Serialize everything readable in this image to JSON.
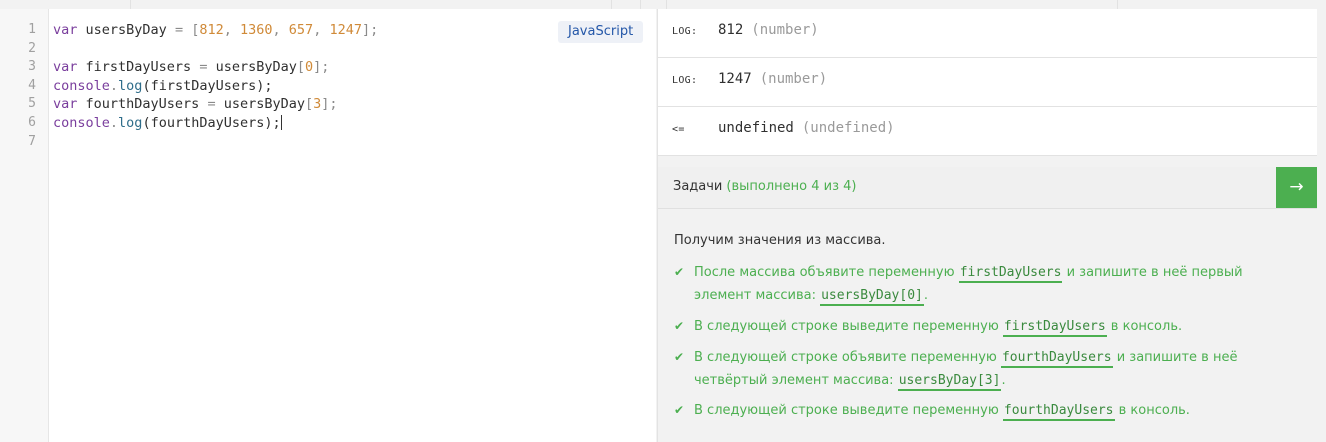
{
  "editor": {
    "language": "JavaScript",
    "line_numbers": [
      "1",
      "2",
      "3",
      "4",
      "5",
      "6",
      "7"
    ],
    "lines": [
      [
        {
          "t": "var",
          "c": "kw"
        },
        {
          "t": " usersByDay "
        },
        {
          "t": "=",
          "c": "punc"
        },
        {
          "t": " "
        },
        {
          "t": "[",
          "c": "punc"
        },
        {
          "t": "812",
          "c": "num"
        },
        {
          "t": ", ",
          "c": "punc"
        },
        {
          "t": "1360",
          "c": "num"
        },
        {
          "t": ", ",
          "c": "punc"
        },
        {
          "t": "657",
          "c": "num"
        },
        {
          "t": ", ",
          "c": "punc"
        },
        {
          "t": "1247",
          "c": "num"
        },
        {
          "t": "];",
          "c": "punc"
        }
      ],
      [],
      [
        {
          "t": "var",
          "c": "kw"
        },
        {
          "t": " firstDayUsers "
        },
        {
          "t": "=",
          "c": "punc"
        },
        {
          "t": " usersByDay"
        },
        {
          "t": "[",
          "c": "punc"
        },
        {
          "t": "0",
          "c": "num"
        },
        {
          "t": "];",
          "c": "punc"
        }
      ],
      [
        {
          "t": "console",
          "c": "kw"
        },
        {
          "t": ".",
          "c": "punc"
        },
        {
          "t": "log",
          "c": "fn"
        },
        {
          "t": "(firstDayUsers);"
        }
      ],
      [
        {
          "t": "var",
          "c": "kw"
        },
        {
          "t": " fourthDayUsers "
        },
        {
          "t": "=",
          "c": "punc"
        },
        {
          "t": " usersByDay"
        },
        {
          "t": "[",
          "c": "punc"
        },
        {
          "t": "3",
          "c": "num"
        },
        {
          "t": "];",
          "c": "punc"
        }
      ],
      [
        {
          "t": "console",
          "c": "kw"
        },
        {
          "t": ".",
          "c": "punc"
        },
        {
          "t": "log",
          "c": "fn"
        },
        {
          "t": "(fourthDayUsers);"
        }
      ],
      []
    ]
  },
  "console": {
    "rows": [
      {
        "tag": "LOG:",
        "value": "812",
        "type": "(number)"
      },
      {
        "tag": "LOG:",
        "value": "1247",
        "type": "(number)"
      },
      {
        "tag": "<=",
        "value": "undefined",
        "type": "(undefined)"
      }
    ]
  },
  "tasks": {
    "title": "Задачи",
    "progress": "(выполнено 4 из 4)",
    "next_icon": "arrow-right-icon",
    "intro": "Получим значения из массива.",
    "items": [
      {
        "parts_a": "После массива объявите переменную ",
        "code_a": "firstDayUsers",
        "parts_b": " и запишите в неё первый элемент массива: ",
        "code_b": "usersByDay[0]",
        "parts_c": "."
      },
      {
        "parts_a": "В следующей строке выведите переменную ",
        "code_a": "firstDayUsers",
        "parts_b": " в консоль.",
        "code_b": "",
        "parts_c": ""
      },
      {
        "parts_a": "В следующей строке объявите переменную ",
        "code_a": "fourthDayUsers",
        "parts_b": " и запишите в неё четвёртый элемент массива: ",
        "code_b": "usersByDay[3]",
        "parts_c": "."
      },
      {
        "parts_a": "В следующей строке выведите переменную ",
        "code_a": "fourthDayUsers",
        "parts_b": " в консоль.",
        "code_b": "",
        "parts_c": ""
      }
    ]
  },
  "colors": {
    "accent_green": "#4caf50",
    "keyword": "#7a3e9d",
    "number": "#d08a38",
    "badge_text": "#2457a8"
  }
}
